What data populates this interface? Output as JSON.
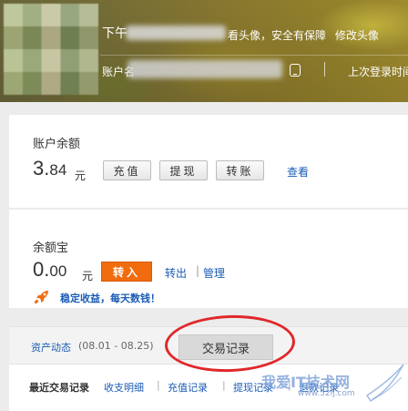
{
  "header": {
    "greeting_prefix": "下午",
    "avatar_links_text": "看头像，安全有保障",
    "modify_avatar": "修改头像",
    "account_prefix": "账户名",
    "last_login": "上次登录时间"
  },
  "balance": {
    "title": "账户余额",
    "amount_int": "3.",
    "amount_dec": "84",
    "unit": "元",
    "recharge_btn": "充值",
    "withdraw_btn": "提现",
    "transfer_btn": "转账",
    "view_link": "查看"
  },
  "yuebao": {
    "title": "余额宝",
    "amount_int": "0.",
    "amount_dec": "00",
    "unit": "元",
    "transfer_in_btn": "转入",
    "transfer_out_link": "转出",
    "separator": "|",
    "manage_link": "管理",
    "promo": "稳定收益，每天数钱！"
  },
  "tabs": {
    "assets_link": "资产动态",
    "assets_range": "(08.01 - 08.25)",
    "transactions_tab": "交易记录"
  },
  "bottom_nav": {
    "recent": "最近交易记录",
    "income": "收支明细",
    "recharge": "充值记录",
    "withdraw": "提现记录",
    "refund": "退款记录",
    "separator": "|"
  },
  "watermark": {
    "text": "我爱IT技术网",
    "url": "www.52ij.com"
  },
  "colors": {
    "link_blue": "#1a5cb5",
    "orange": "#f06c0e",
    "annotation_red": "#e0282a"
  }
}
